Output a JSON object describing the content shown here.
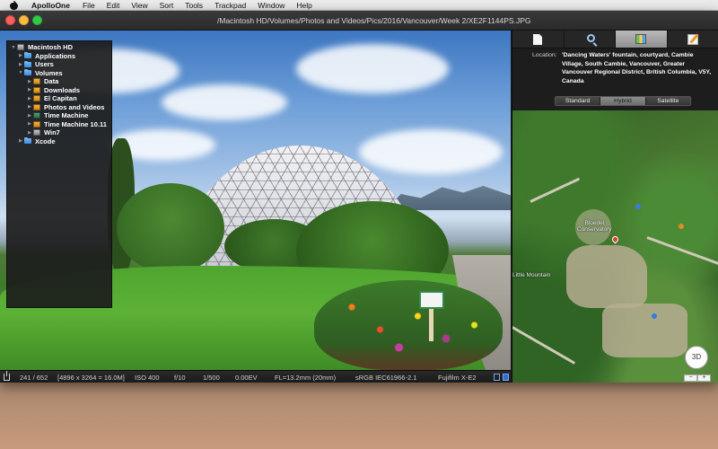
{
  "menubar": {
    "app_name": "ApolloOne",
    "items": [
      "File",
      "Edit",
      "View",
      "Sort",
      "Tools",
      "Trackpad",
      "Window",
      "Help"
    ]
  },
  "window": {
    "title": "/Macintosh HD/Volumes/Photos and Videos/Pics/2016/Vancouver/Week 2/XE2F1144PS.JPG"
  },
  "folder_tree": {
    "items": [
      {
        "label": "Macintosh HD",
        "icon": "disk-icon",
        "depth": 0,
        "expanded": true
      },
      {
        "label": "Applications",
        "icon": "folder-icon",
        "depth": 1,
        "expanded": false
      },
      {
        "label": "Users",
        "icon": "folder-icon",
        "depth": 1,
        "expanded": false
      },
      {
        "label": "Volumes",
        "icon": "folder-icon",
        "depth": 1,
        "expanded": true
      },
      {
        "label": "Data",
        "icon": "drive-icon",
        "depth": 2,
        "expanded": false
      },
      {
        "label": "Downloads",
        "icon": "drive-icon",
        "depth": 2,
        "expanded": false
      },
      {
        "label": "El Capitan",
        "icon": "drive-icon",
        "depth": 2,
        "expanded": false
      },
      {
        "label": "Photos and Videos",
        "icon": "drive-icon",
        "depth": 2,
        "expanded": false
      },
      {
        "label": "Time Machine",
        "icon": "tm-icon",
        "depth": 2,
        "expanded": false
      },
      {
        "label": "Time Machine 10.11",
        "icon": "drive-icon",
        "depth": 2,
        "expanded": false
      },
      {
        "label": "Win7",
        "icon": "disk-icon",
        "depth": 2,
        "expanded": false
      },
      {
        "label": "Xcode",
        "icon": "folder-icon",
        "depth": 0,
        "expanded": false
      }
    ]
  },
  "statusbar": {
    "index": "241 / 652",
    "dimensions": "[4896 x 3264 = 16.0M]",
    "iso": "ISO 400",
    "aperture": "f/10",
    "shutter": "1/500",
    "exposure": "0.00EV",
    "focal_length": "FL=13.2mm (20mm)",
    "color_profile": "sRGB IEC61966-2.1",
    "camera": "Fujifilm X-E2"
  },
  "inspector": {
    "tabs": [
      {
        "name": "info",
        "icon": "document-icon",
        "active": false
      },
      {
        "name": "search",
        "icon": "magnifier-icon",
        "active": false
      },
      {
        "name": "map",
        "icon": "map-icon",
        "active": true
      },
      {
        "name": "edit",
        "icon": "pencil-icon",
        "active": false
      }
    ],
    "location_label": "Location:",
    "location_value": "'Dancing Waters' fountain, courtyard, Cambie Village, South Cambie, Vancouver, Greater Vancouver Regional District, British Columbia, V5Y, Canada",
    "map_types": [
      "Standard",
      "Hybrid",
      "Satellite"
    ],
    "map_type_selected": "Hybrid",
    "map_labels": {
      "conservatory": "Bloedel\nConservatory",
      "mountain": "Little Mountain"
    },
    "btn_3d": "3D",
    "zoom_out": "−",
    "zoom_in": "+"
  }
}
